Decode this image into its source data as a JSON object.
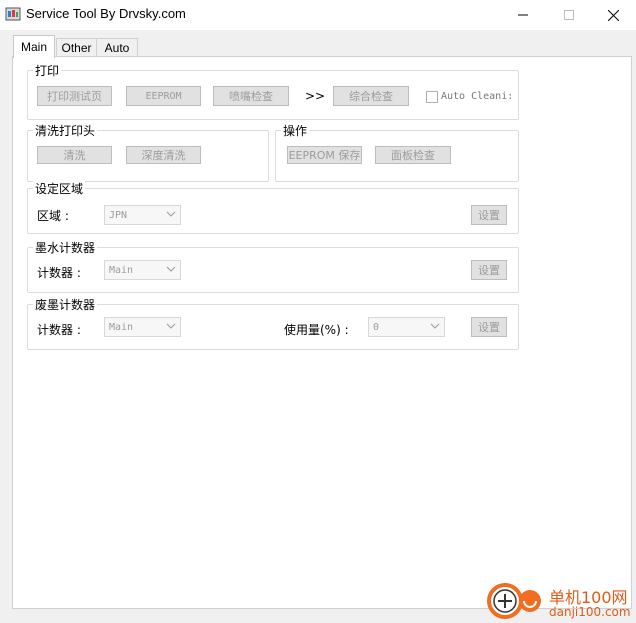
{
  "window": {
    "title": "Service Tool By Drvsky.com"
  },
  "tabs": [
    {
      "label": "Main"
    },
    {
      "label": "Other"
    },
    {
      "label": "Auto"
    }
  ],
  "print_group": {
    "title": "打印",
    "print_test_page": "打印测试页",
    "eeprom": "EEPROM",
    "nozzle_check": "喷嘴检查",
    "arrow": ">>",
    "comprehensive_check": "综合检查",
    "auto_cleaning": "Auto Cleani:"
  },
  "clean_group": {
    "title": "清洗打印头",
    "clean": "清洗",
    "deep_clean": "深度清洗"
  },
  "ops_group": {
    "title": "操作",
    "eeprom_save": "EEPROM 保存",
    "panel_check": "面板检查"
  },
  "region_group": {
    "title": "设定区域",
    "label": "区域 :",
    "value": "JPN",
    "set": "设置"
  },
  "ink_counter_group": {
    "title": "墨水计数器",
    "label": "计数器 :",
    "value": "Main",
    "set": "设置"
  },
  "waste_counter_group": {
    "title": "废墨计数器",
    "label": "计数器 :",
    "value": "Main",
    "usage_label": "使用量(%) :",
    "usage_value": "0",
    "set": "设置"
  },
  "watermark": {
    "line1": "单机100网",
    "line2": "danji100.com"
  },
  "colors": {
    "button_bg": "#e1e1e1",
    "disabled_text": "#9c9c9c",
    "brand_orange": "#f26d1f"
  }
}
